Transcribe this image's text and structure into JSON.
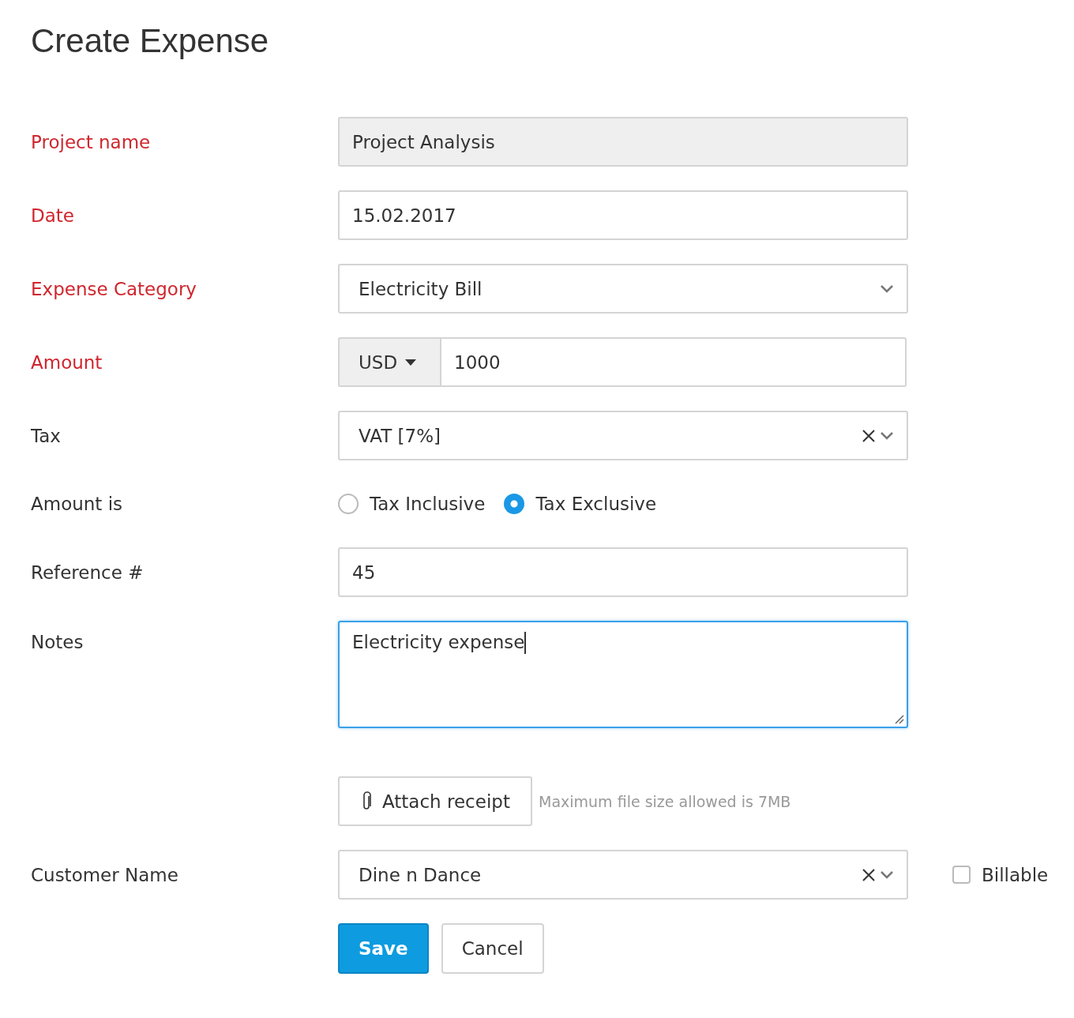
{
  "title": "Create Expense",
  "fields": [
    {
      "kind": "readonly",
      "label": "Project name",
      "required": true,
      "value": "Project Analysis"
    },
    {
      "kind": "text",
      "label": "Date",
      "required": true,
      "value": "15.02.2017"
    },
    {
      "kind": "select",
      "label": "Expense Category",
      "required": true,
      "value": "Electricity Bill",
      "clearable": false
    },
    {
      "kind": "amount",
      "label": "Amount",
      "required": true,
      "currency": "USD",
      "value": "1000"
    },
    {
      "kind": "select",
      "label": "Tax",
      "required": false,
      "value": "VAT [7%]",
      "clearable": true
    },
    {
      "kind": "radio",
      "label": "Amount is",
      "required": false,
      "options": [
        {
          "label": "Tax Inclusive",
          "selected": false
        },
        {
          "label": "Tax Exclusive",
          "selected": true
        }
      ]
    },
    {
      "kind": "text",
      "label": "Reference #",
      "required": false,
      "value": "45"
    },
    {
      "kind": "textarea",
      "label": "Notes",
      "required": false,
      "value": "Electricity expense",
      "focused": true
    },
    {
      "kind": "attach",
      "button": "Attach receipt",
      "hint": "Maximum file size allowed is 7MB"
    },
    {
      "kind": "select",
      "label": "Customer Name",
      "required": false,
      "value": "Dine n Dance",
      "clearable": true,
      "checkbox": {
        "label": "Billable",
        "checked": false
      }
    }
  ],
  "buttons": [
    {
      "label": "Save",
      "kind": "primary"
    },
    {
      "label": "Cancel",
      "kind": "secondary"
    }
  ]
}
